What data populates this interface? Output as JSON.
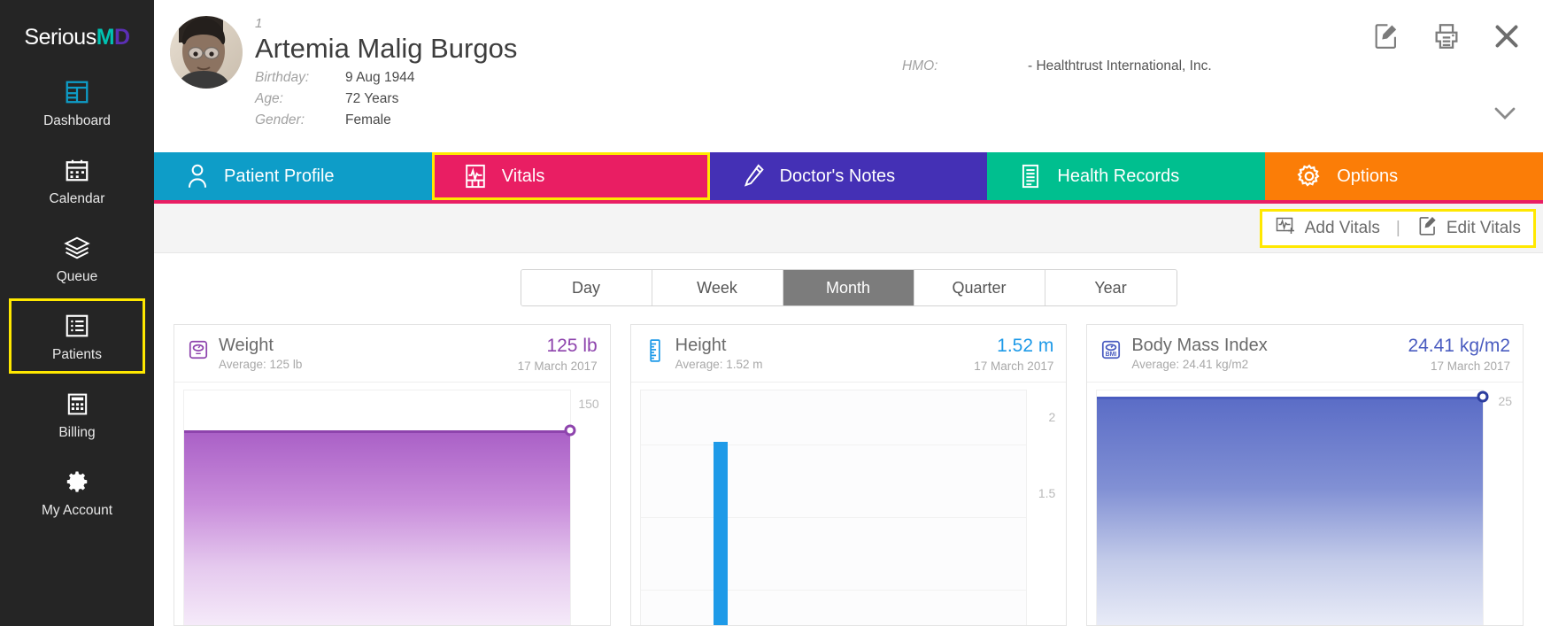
{
  "brand": {
    "name_part1": "Serious",
    "name_part2": "M",
    "name_part3": "D"
  },
  "sidebar": {
    "items": [
      {
        "label": "Dashboard",
        "icon": "dashboard-icon",
        "highlighted": false
      },
      {
        "label": "Calendar",
        "icon": "calendar-icon",
        "highlighted": false
      },
      {
        "label": "Queue",
        "icon": "layers-icon",
        "highlighted": false
      },
      {
        "label": "Patients",
        "icon": "list-icon",
        "highlighted": true
      },
      {
        "label": "Billing",
        "icon": "calculator-icon",
        "highlighted": false
      },
      {
        "label": "My Account",
        "icon": "gear-icon",
        "highlighted": false
      }
    ]
  },
  "patient": {
    "number": "1",
    "name": "Artemia Malig Burgos",
    "fields": [
      {
        "label": "Birthday:",
        "value": "9 Aug 1944"
      },
      {
        "label": "Age:",
        "value": "72 Years"
      },
      {
        "label": "Gender:",
        "value": "Female"
      }
    ],
    "hmo_label": "HMO:",
    "hmo_value": "- Healthtrust International, Inc."
  },
  "header_actions": [
    {
      "name": "edit-note-icon",
      "title": "Edit"
    },
    {
      "name": "print-icon",
      "title": "Print"
    },
    {
      "name": "close-icon",
      "title": "Close"
    }
  ],
  "expand_icon": "chevron-down-icon",
  "tabs": [
    {
      "label": "Patient Profile",
      "icon": "person-icon",
      "color": "#0e9dc8",
      "selected": false
    },
    {
      "label": "Vitals",
      "icon": "vitals-icon",
      "color": "#e91e63",
      "selected": true
    },
    {
      "label": "Doctor's Notes",
      "icon": "pen-icon",
      "color": "#4430b5",
      "selected": false
    },
    {
      "label": "Health Records",
      "icon": "records-icon",
      "color": "#00bf8f",
      "selected": false
    },
    {
      "label": "Options",
      "icon": "gear-icon",
      "color": "#fb7d07",
      "selected": false
    }
  ],
  "toolbar": {
    "add_label": "Add Vitals",
    "separator": "|",
    "edit_label": "Edit Vitals",
    "add_icon": "add-vitals-icon",
    "edit_icon": "edit-vitals-icon"
  },
  "period_selector": {
    "options": [
      "Day",
      "Week",
      "Month",
      "Quarter",
      "Year"
    ],
    "selected": "Month"
  },
  "cards": [
    {
      "title": "Weight",
      "icon": "scale-icon",
      "average": "Average: 125 lb",
      "value": "125 lb",
      "date": "17 March 2017",
      "accent": "#8e44ad",
      "value_color": "#8e44ad"
    },
    {
      "title": "Height",
      "icon": "ruler-icon",
      "average": "Average: 1.52 m",
      "value": "1.52 m",
      "date": "17 March 2017",
      "accent": "#1e9ae8",
      "value_color": "#1e9ae8"
    },
    {
      "title": "Body Mass Index",
      "icon": "bmi-icon",
      "average": "Average: 24.41 kg/m2",
      "value": "24.41 kg/m2",
      "date": "17 March 2017",
      "accent": "#4a5cc0",
      "value_color": "#4a5cc0"
    }
  ],
  "chart_data": [
    {
      "type": "area",
      "title": "Weight",
      "categories": [
        "17 March 2017"
      ],
      "values": [
        125
      ],
      "unit": "lb",
      "ytick_labels": [
        "150"
      ],
      "yticks": [
        150
      ],
      "ylim": [
        0,
        165
      ],
      "xlabel": "",
      "ylabel": "",
      "grid": true,
      "legend": "none",
      "line_color": "#8e44ad",
      "fill_top": "#a860c4",
      "fill_bottom": "#f2e4f7"
    },
    {
      "type": "bar",
      "title": "Height",
      "categories": [
        "17 March 2017"
      ],
      "values": [
        1.52
      ],
      "unit": "m",
      "ytick_labels": [
        "2",
        "1.5"
      ],
      "yticks": [
        2,
        1.5
      ],
      "ylim": [
        0,
        2.2
      ],
      "xlabel": "",
      "ylabel": "",
      "grid": true,
      "legend": "none",
      "bar_color": "#1e9ae8"
    },
    {
      "type": "area",
      "title": "Body Mass Index",
      "categories": [
        "17 March 2017"
      ],
      "values": [
        24.41
      ],
      "unit": "kg/m2",
      "ytick_labels": [
        "25"
      ],
      "yticks": [
        25
      ],
      "ylim": [
        0,
        25.5
      ],
      "xlabel": "",
      "ylabel": "",
      "grid": true,
      "legend": "none",
      "line_color": "#4a5cc0",
      "fill_top": "#6a7ccd",
      "fill_bottom": "#e4e7f6"
    }
  ]
}
